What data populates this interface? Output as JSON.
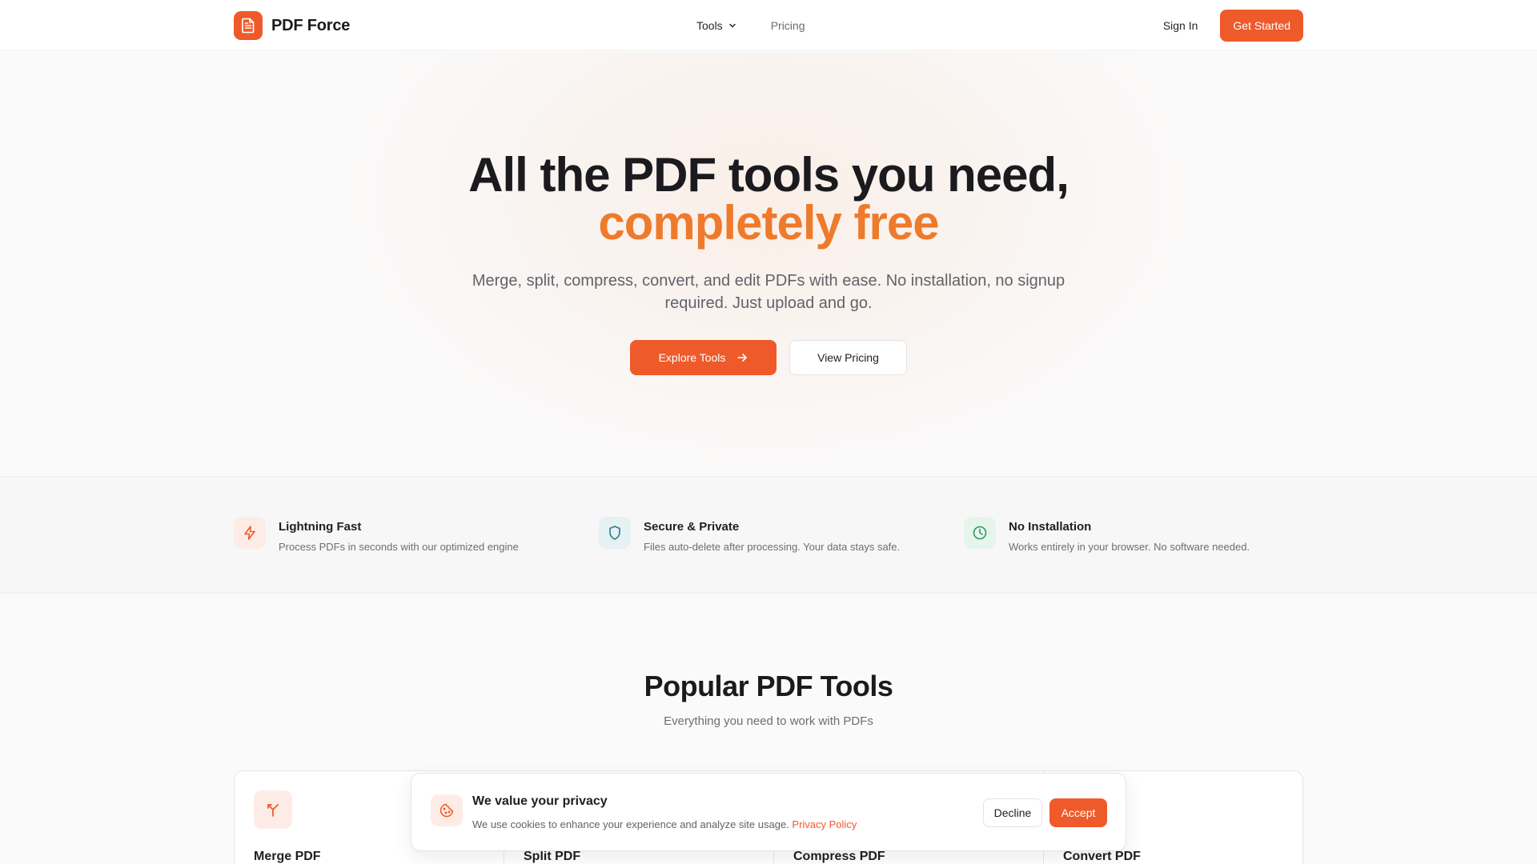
{
  "colors": {
    "brand": "#ef5a2a",
    "accent_text": "#ee7a2b",
    "text": "#1f1f23",
    "muted": "#6d6d74"
  },
  "nav": {
    "brand_name": "PDF Force",
    "brand_icon": "document-icon",
    "links": [
      {
        "label": "Tools",
        "icon": "chevron-down-icon"
      },
      {
        "label": "Pricing"
      }
    ],
    "sign_in": "Sign In",
    "get_started": "Get Started"
  },
  "hero": {
    "title": "All the PDF tools you need,",
    "title_accent": "completely free",
    "subtitle": "Merge, split, compress, convert, and edit PDFs with ease. No installation, no signup required. Just upload and go.",
    "primary_cta": "Explore Tools",
    "primary_cta_icon": "arrow-right-icon",
    "secondary_cta": "View Pricing"
  },
  "features": [
    {
      "title": "Lightning Fast",
      "description": "Process PDFs in seconds with our optimized engine",
      "icon": "lightning-icon",
      "icon_color": "#ef5a2a",
      "icon_bg": "#fdece5"
    },
    {
      "title": "Secure & Private",
      "description": "Files auto-delete after processing. Your data stays safe.",
      "icon": "shield-icon",
      "icon_color": "#2a7d8c",
      "icon_bg": "#e5f1f3"
    },
    {
      "title": "No Installation",
      "description": "Works entirely in your browser. No software needed.",
      "icon": "clock-icon",
      "icon_color": "#2a9a5a",
      "icon_bg": "#e6f5ec"
    }
  ],
  "popular": {
    "title": "Popular PDF Tools",
    "subtitle": "Everything you need to work with PDFs",
    "tools": [
      {
        "name": "Merge PDF",
        "icon": "merge-icon"
      },
      {
        "name": "Split PDF",
        "icon": "split-icon"
      },
      {
        "name": "Compress PDF",
        "icon": "compress-icon"
      },
      {
        "name": "Convert PDF",
        "icon": "convert-icon"
      }
    ]
  },
  "cookie": {
    "title": "We value your privacy",
    "text": "We use cookies to enhance your experience and analyze site usage.",
    "link": "Privacy Policy",
    "decline": "Decline",
    "accept": "Accept",
    "icon": "cookie-icon"
  }
}
